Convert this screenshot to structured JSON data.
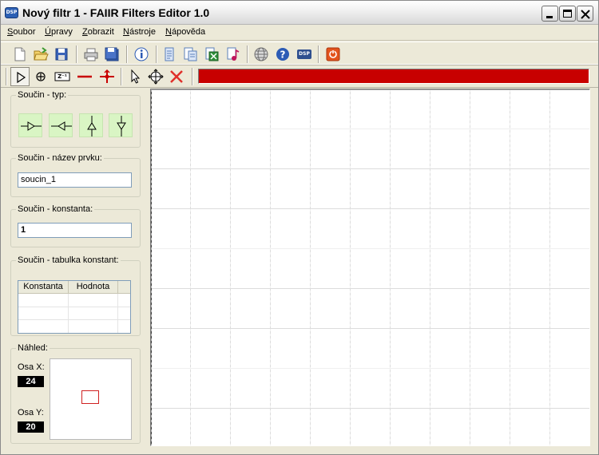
{
  "window": {
    "title": "Nový filtr 1 - FAIIR Filters Editor 1.0",
    "app_icon_text": "DSP"
  },
  "menu": {
    "items": [
      "Soubor",
      "Úpravy",
      "Zobrazit",
      "Nástroje",
      "Nápověda"
    ]
  },
  "toolbar_main": {
    "icons": [
      "new-file-icon",
      "open-folder-icon",
      "save-icon",
      "print-icon",
      "save-as-icon",
      "info-icon",
      "document-icon",
      "export-icon",
      "excel-export-icon",
      "audio-export-icon",
      "globe-icon",
      "help-icon",
      "dsp-icon",
      "exit-icon"
    ],
    "dsp_label": "DSP"
  },
  "toolbar_tools": {
    "icons": [
      "run-arrow-icon",
      "adder-icon",
      "delay-icon",
      "line-icon",
      "branch-icon",
      "pointer-icon",
      "move-icon",
      "delete-icon"
    ],
    "delay_label": "Z⁻¹",
    "progress_color": "#c80000"
  },
  "left_panel": {
    "type_group": {
      "label": "Součin - typ:",
      "buttons": [
        "multiplier-right-icon",
        "multiplier-left-icon",
        "multiplier-up-icon",
        "multiplier-down-icon"
      ]
    },
    "name_group": {
      "label": "Součin - název prvku:",
      "value": "soucin_1"
    },
    "constant_group": {
      "label": "Součin - konstanta:",
      "value": "1"
    },
    "table_group": {
      "label": "Součin - tabulka konstant:",
      "columns": [
        "Konstanta",
        "Hodnota"
      ]
    },
    "preview_group": {
      "label": "Náhled:",
      "axis_x_label": "Osa X:",
      "axis_x_value": "24",
      "axis_y_label": "Osa Y:",
      "axis_y_value": "20"
    }
  },
  "colors": {
    "accent_red": "#c80000",
    "type_button_bg": "#d9f5c4"
  }
}
